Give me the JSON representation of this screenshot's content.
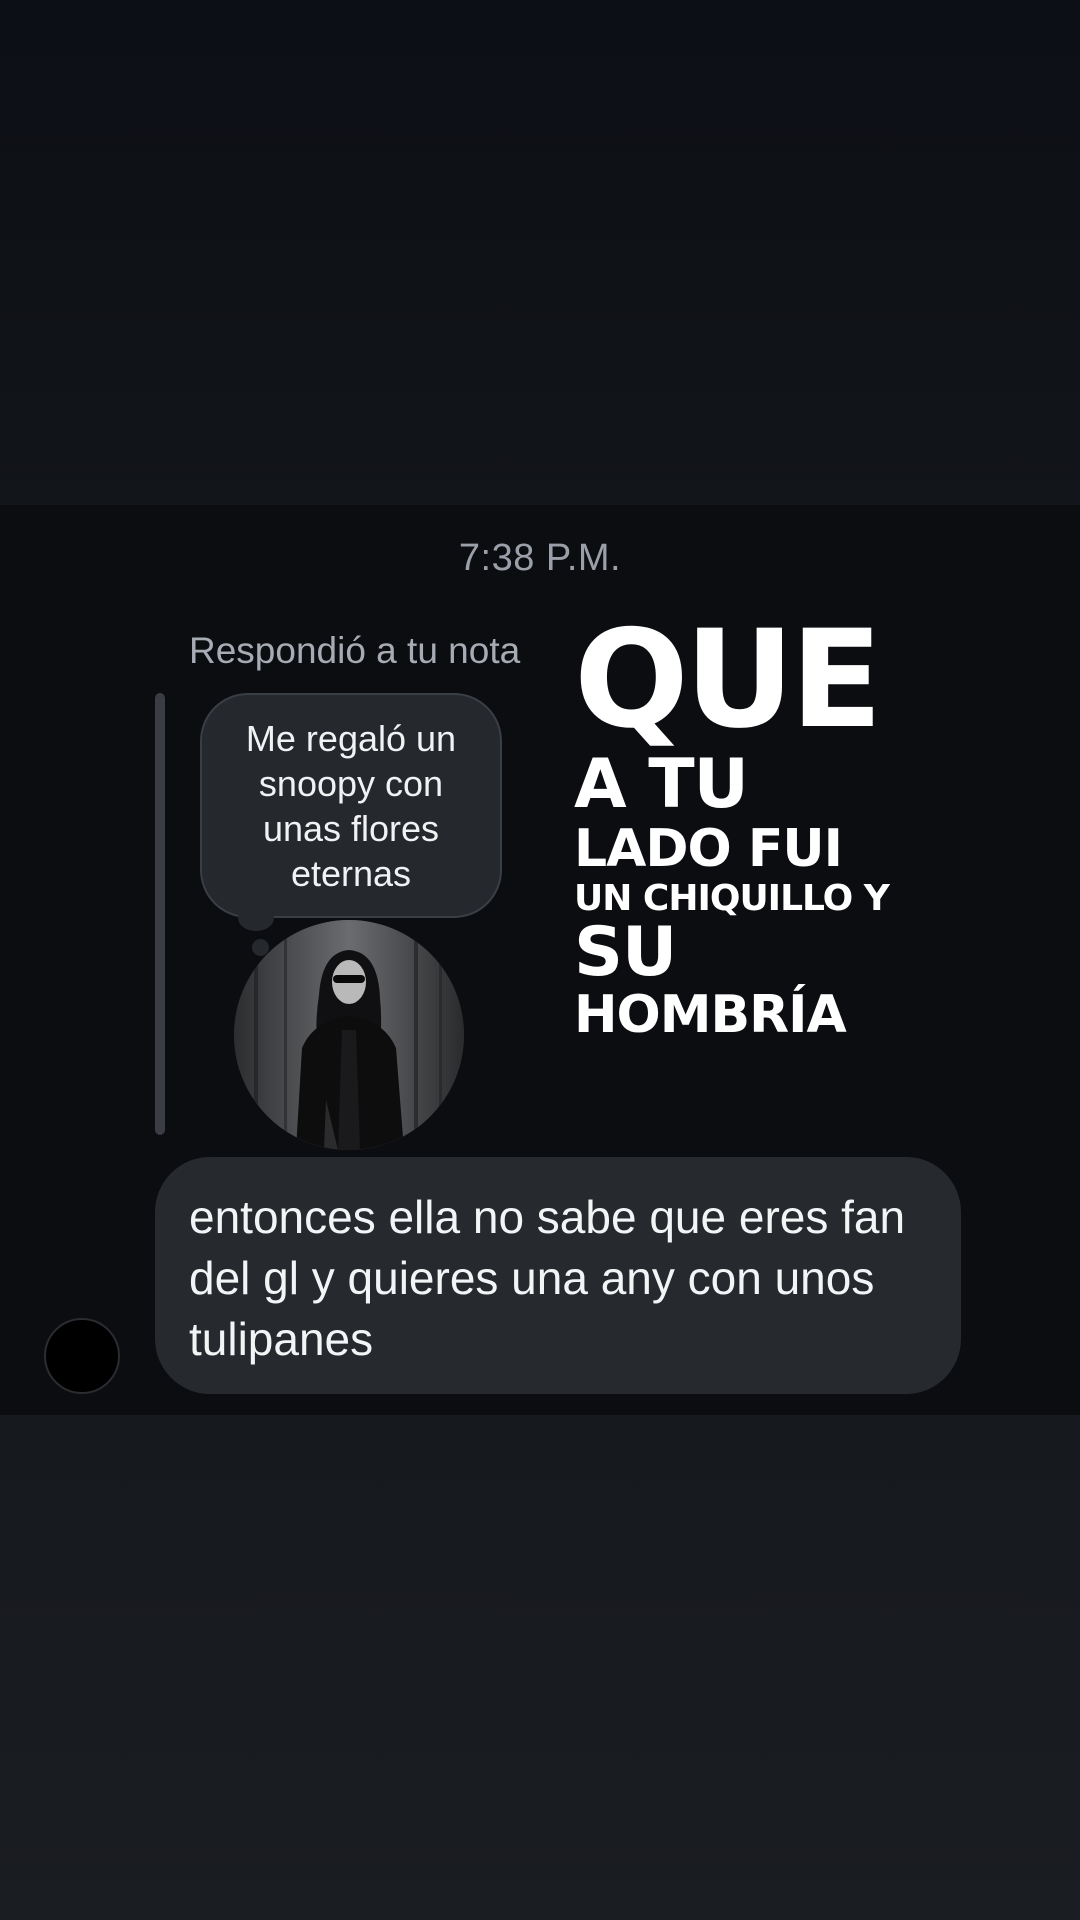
{
  "timestamp": "7:38 P.M.",
  "reply": {
    "label": "Respondió a tu nota",
    "note_text": "Me regaló un snoopy con unas flores eternas",
    "avatar_icon": "profile-photo"
  },
  "overlay_lyrics": {
    "line1": "QUE",
    "line2": "A TU",
    "line3": "LADO FUI",
    "line4": "UN CHIQUILLO Y",
    "line5": "SU",
    "line6": "HOMBRÍA"
  },
  "message": {
    "text": "entonces ella no sabe que eres fan del gl y quieres una any con unos tulipanes"
  },
  "sender": {
    "avatar_color": "#000000"
  },
  "colors": {
    "bubble": "#26292e",
    "timestamp": "#9b9fa8",
    "background": "#0b0d11"
  }
}
